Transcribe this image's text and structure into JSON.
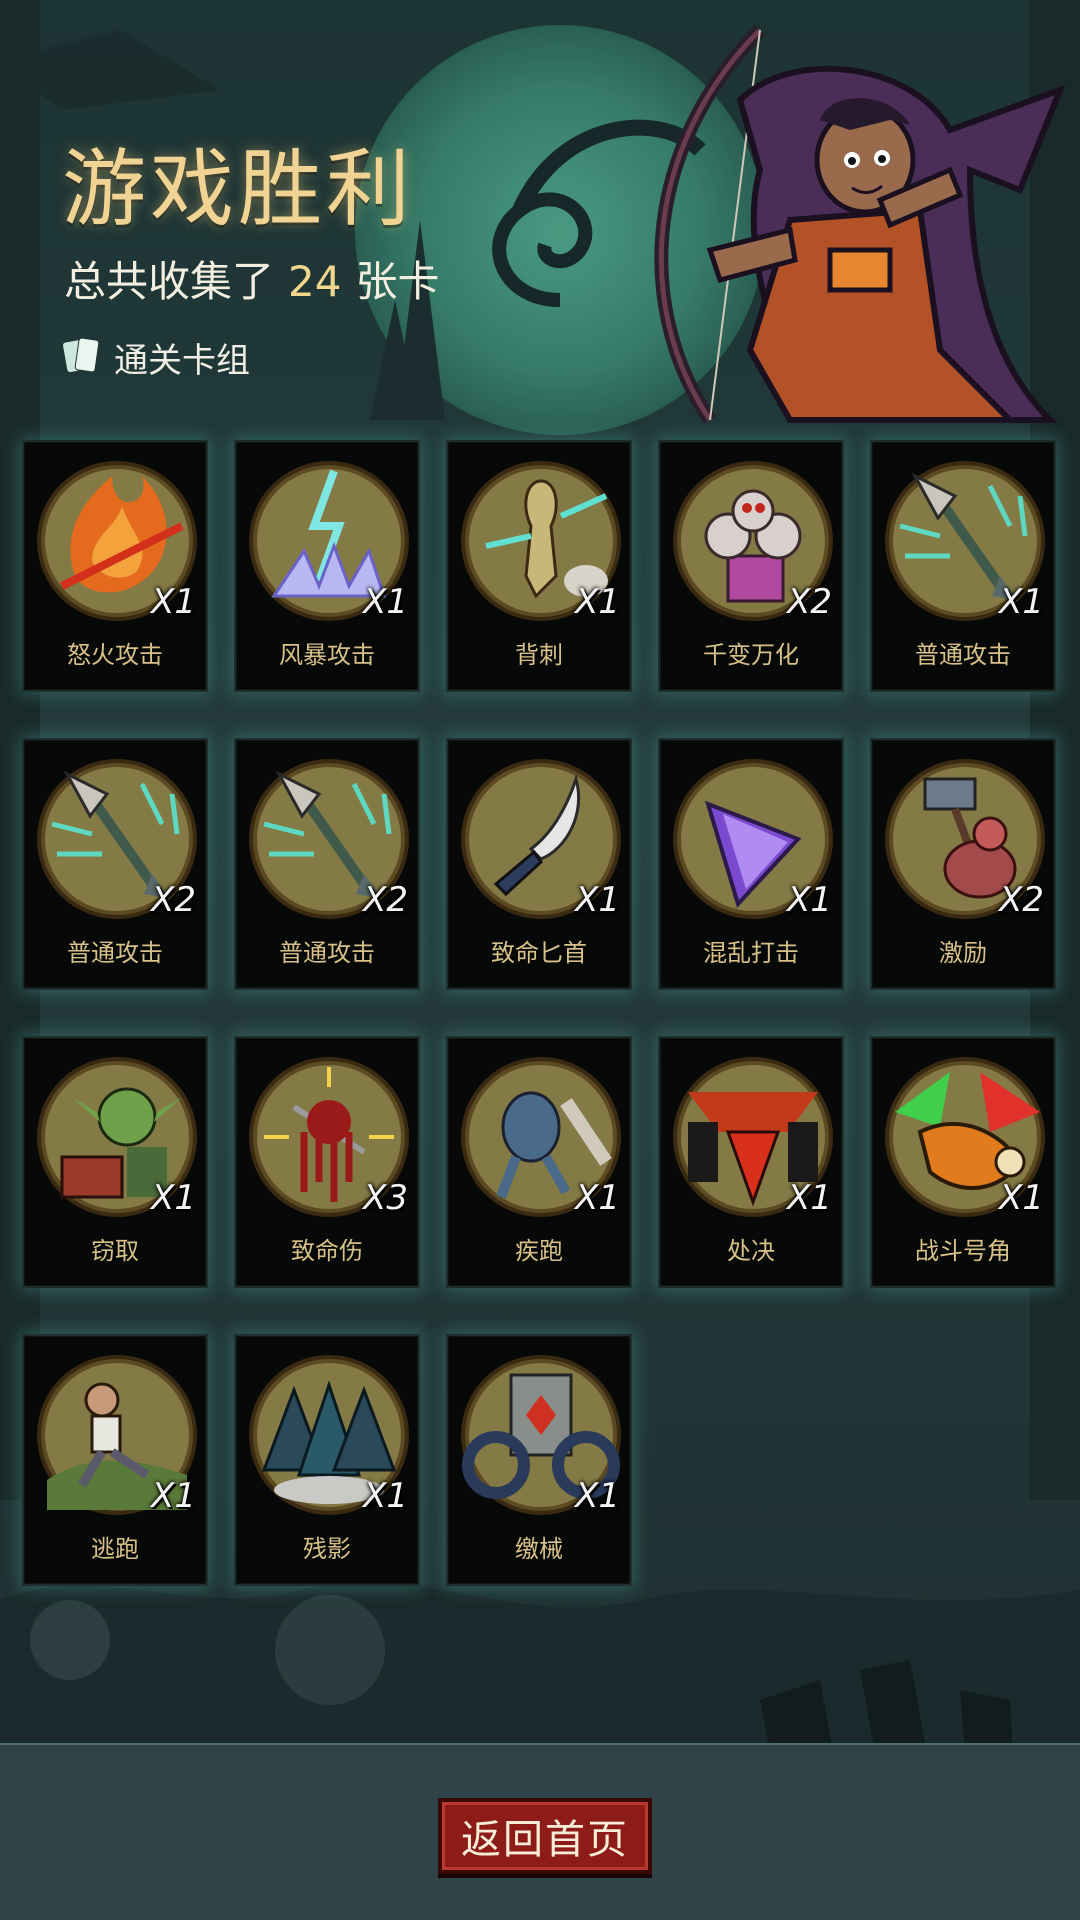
{
  "header": {
    "title": "游戏胜利",
    "collected_prefix": "总共收集了",
    "collected_count": "24",
    "collected_suffix": "张卡",
    "deck_label": "通关卡组"
  },
  "cards": [
    {
      "name": "怒火攻击",
      "count": "X1",
      "icon": "fire-slash-icon"
    },
    {
      "name": "风暴攻击",
      "count": "X1",
      "icon": "lightning-storm-icon"
    },
    {
      "name": "背刺",
      "count": "X1",
      "icon": "backstab-icon"
    },
    {
      "name": "千变万化",
      "count": "X2",
      "icon": "puppet-box-icon"
    },
    {
      "name": "普通攻击",
      "count": "X1",
      "icon": "arrow-strike-icon"
    },
    {
      "name": "普通攻击",
      "count": "X2",
      "icon": "arrow-strike-icon"
    },
    {
      "name": "普通攻击",
      "count": "X2",
      "icon": "arrow-strike-icon"
    },
    {
      "name": "致命匕首",
      "count": "X1",
      "icon": "dagger-icon"
    },
    {
      "name": "混乱打击",
      "count": "X1",
      "icon": "purple-blade-icon"
    },
    {
      "name": "激励",
      "count": "X2",
      "icon": "hammer-warrior-icon"
    },
    {
      "name": "窃取",
      "count": "X1",
      "icon": "goblin-chest-icon"
    },
    {
      "name": "致命伤",
      "count": "X3",
      "icon": "bleeding-wound-icon"
    },
    {
      "name": "疾跑",
      "count": "X1",
      "icon": "sprinting-beast-icon"
    },
    {
      "name": "处决",
      "count": "X1",
      "icon": "execution-icon"
    },
    {
      "name": "战斗号角",
      "count": "X1",
      "icon": "war-horn-icon"
    },
    {
      "name": "逃跑",
      "count": "X1",
      "icon": "fleeing-man-icon"
    },
    {
      "name": "残影",
      "count": "X1",
      "icon": "shadow-clones-icon"
    },
    {
      "name": "缴械",
      "count": "X1",
      "icon": "disarm-shield-icon"
    }
  ],
  "return_button": "返回首页",
  "colors": {
    "title": "#f1d493",
    "count_highlight": "#f1d78e",
    "card_label": "#d8c188",
    "button_red": "#8d1b17",
    "card_glow": "#5ad2be"
  }
}
